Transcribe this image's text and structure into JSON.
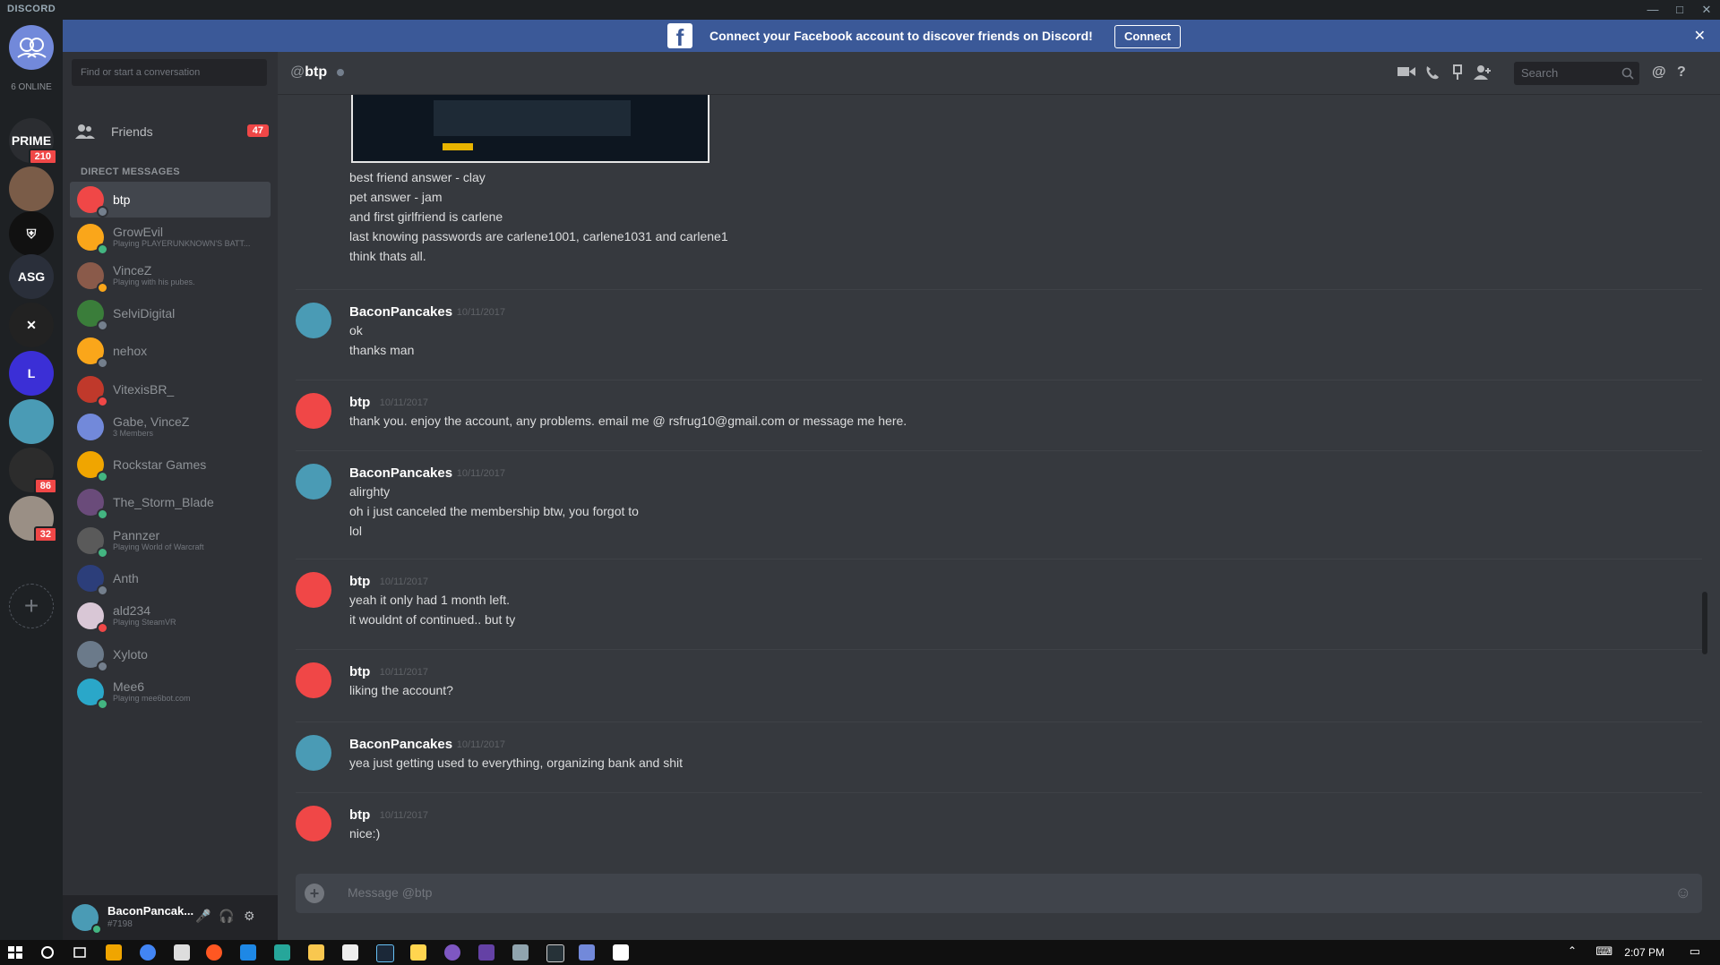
{
  "window": {
    "brand": "DISCORD",
    "minimize": "—",
    "maximize": "□",
    "close": "✕"
  },
  "rail": {
    "online_count": "6 ONLINE",
    "servers": [
      {
        "name": "friends-home",
        "color": "#7289da",
        "glyph": "👥"
      },
      {
        "name": "prime-duels",
        "color": "#2b2d31",
        "glyph": "PRIME",
        "badge": "210"
      },
      {
        "name": "server-person",
        "color": "#7a5c48",
        "glyph": ""
      },
      {
        "name": "spartan",
        "color": "#111",
        "glyph": "⛨"
      },
      {
        "name": "asg",
        "color": "#2a2f3a",
        "glyph": "ASG"
      },
      {
        "name": "x-server",
        "color": "#222",
        "glyph": "✕"
      },
      {
        "name": "l-server",
        "color": "#3b2fd6",
        "glyph": "L"
      },
      {
        "name": "pancake",
        "color": "#4a9bb5",
        "glyph": ""
      },
      {
        "name": "dark-server",
        "color": "#2c2c2c",
        "glyph": "",
        "badge": "86"
      },
      {
        "name": "raccoon",
        "color": "#9a8f85",
        "glyph": "",
        "badge": "32"
      }
    ],
    "add_label": "+"
  },
  "banner": {
    "message": "Connect your Facebook account to discover friends on Discord!",
    "button": "Connect",
    "close": "✕"
  },
  "sidebar": {
    "search_placeholder": "Find or start a conversation",
    "friends_label": "Friends",
    "friends_badge": "47",
    "section_label": "DIRECT MESSAGES",
    "dms": [
      {
        "name": "btp",
        "sub": "",
        "color": "#f04747",
        "status": "#747f8d",
        "active": true
      },
      {
        "name": "GrowEvil",
        "sub": "Playing PLAYERUNKNOWN'S BATT...",
        "color": "#faa61a",
        "status": "#43b581"
      },
      {
        "name": "VinceZ",
        "sub": "Playing with his pubes.",
        "color": "#8a5a4a",
        "status": "#faa61a"
      },
      {
        "name": "SelviDigital",
        "sub": "",
        "color": "#3a7d3a",
        "status": "#747f8d"
      },
      {
        "name": "nehox",
        "sub": "",
        "color": "#faa61a",
        "status": "#747f8d"
      },
      {
        "name": "VitexisBR_",
        "sub": "",
        "color": "#c0392b",
        "status": "#f04747"
      },
      {
        "name": "Gabe, VinceZ",
        "sub": "3 Members",
        "color": "#7289da",
        "status": ""
      },
      {
        "name": "Rockstar Games",
        "sub": "",
        "color": "#f0a500",
        "status": "#43b581"
      },
      {
        "name": "The_Storm_Blade",
        "sub": "",
        "color": "#6a4b7a",
        "status": "#43b581"
      },
      {
        "name": "Pannzer",
        "sub": "Playing World of Warcraft",
        "color": "#5a5a5a",
        "status": "#43b581"
      },
      {
        "name": "Anth",
        "sub": "",
        "color": "#2c3e7a",
        "status": "#747f8d"
      },
      {
        "name": "ald234",
        "sub": "Playing SteamVR",
        "color": "#d9c7d6",
        "status": "#f04747"
      },
      {
        "name": "Xyloto",
        "sub": "",
        "color": "#6b7a8a",
        "status": "#747f8d"
      },
      {
        "name": "Mee6",
        "sub": "Playing mee6bot.com",
        "color": "#2aa7c9",
        "status": "#43b581"
      }
    ]
  },
  "user": {
    "name": "BaconPancak...",
    "tag": "#7198",
    "mic": "🎤",
    "headset": "🎧",
    "settings": "⚙"
  },
  "chat": {
    "at": "@",
    "title": "btp",
    "search_placeholder": "Search",
    "icons": [
      "video-icon",
      "call-icon",
      "pin-icon",
      "add-friend-icon",
      "mention-icon",
      "help-icon"
    ],
    "top_lines": [
      "best friend answer - clay",
      "pet answer - jam",
      "and first girlfriend is carlene",
      "last knowing passwords are carlene1001, carlene1031 and carlene1",
      "think thats all."
    ],
    "messages": [
      {
        "author": "BaconPancakes",
        "time": "10/11/2017",
        "avatar": "#4a9bb5",
        "lines": [
          "ok",
          "thanks man"
        ]
      },
      {
        "author": "btp",
        "time": "10/11/2017",
        "avatar": "#f04747",
        "lines": [
          "thank you. enjoy the account, any problems. email me @ rsfrug10@gmail.com or message me here."
        ]
      },
      {
        "author": "BaconPancakes",
        "time": "10/11/2017",
        "avatar": "#4a9bb5",
        "lines": [
          "alirghty",
          "oh i just canceled the membership btw, you forgot to",
          "lol"
        ]
      },
      {
        "author": "btp",
        "time": "10/11/2017",
        "avatar": "#f04747",
        "lines": [
          "yeah it only had 1 month left.",
          "it wouldnt of continued.. but ty"
        ]
      },
      {
        "author": "btp",
        "time": "10/11/2017",
        "avatar": "#f04747",
        "lines": [
          "liking the account?"
        ]
      },
      {
        "author": "BaconPancakes",
        "time": "10/11/2017",
        "avatar": "#4a9bb5",
        "lines": [
          "yea just getting used to everything, organizing bank and shit"
        ]
      },
      {
        "author": "btp",
        "time": "10/11/2017",
        "avatar": "#f04747",
        "lines": [
          "nice:)"
        ]
      }
    ],
    "composer_placeholder": "Message @btp"
  },
  "taskbar": {
    "time": "2:07 PM"
  }
}
